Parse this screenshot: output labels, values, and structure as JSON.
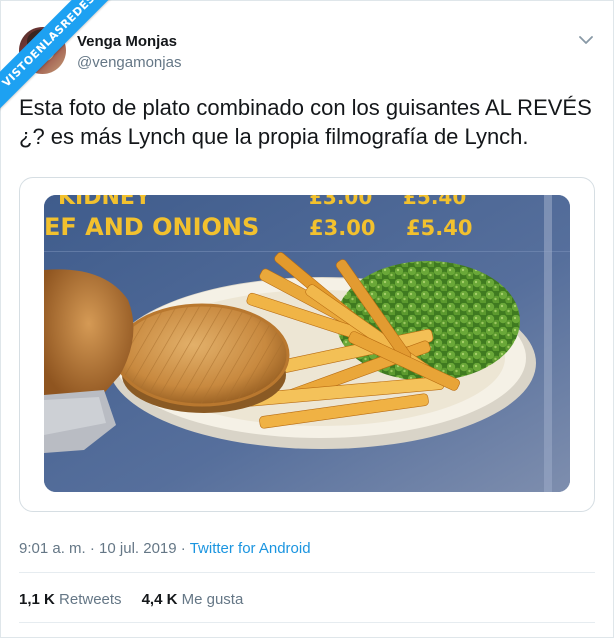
{
  "watermark": {
    "text": "VISTOENLASREDES"
  },
  "author": {
    "display_name": "Venga Monjas",
    "handle": "@vengamonjas"
  },
  "icons": {
    "menu": "chevron-down-icon"
  },
  "tweet": {
    "text": "Esta foto de plato combinado con los guisantes AL REVÉS\n¿? es más Lynch que la propia filmografía de Lynch."
  },
  "photo": {
    "menu_line_1": "KIDNEY",
    "menu_line_1_price_a": "£3.00",
    "menu_line_1_price_b": "£5.40",
    "menu_line_2": "EF AND ONIONS",
    "menu_line_2_price_a": "£3.00",
    "menu_line_2_price_b": "£5.40"
  },
  "meta": {
    "time": "9:01 a. m.",
    "sep1": " · ",
    "date": "10 jul. 2019",
    "sep2": " · ",
    "source": "Twitter for Android"
  },
  "stats": {
    "retweets_count": "1,1 K",
    "retweets_label": "Retweets",
    "likes_count": "4,4 K",
    "likes_label": "Me gusta"
  },
  "colors": {
    "link": "#1b95e0",
    "secondary_text": "#657786",
    "watermark": "#1da1f2"
  }
}
